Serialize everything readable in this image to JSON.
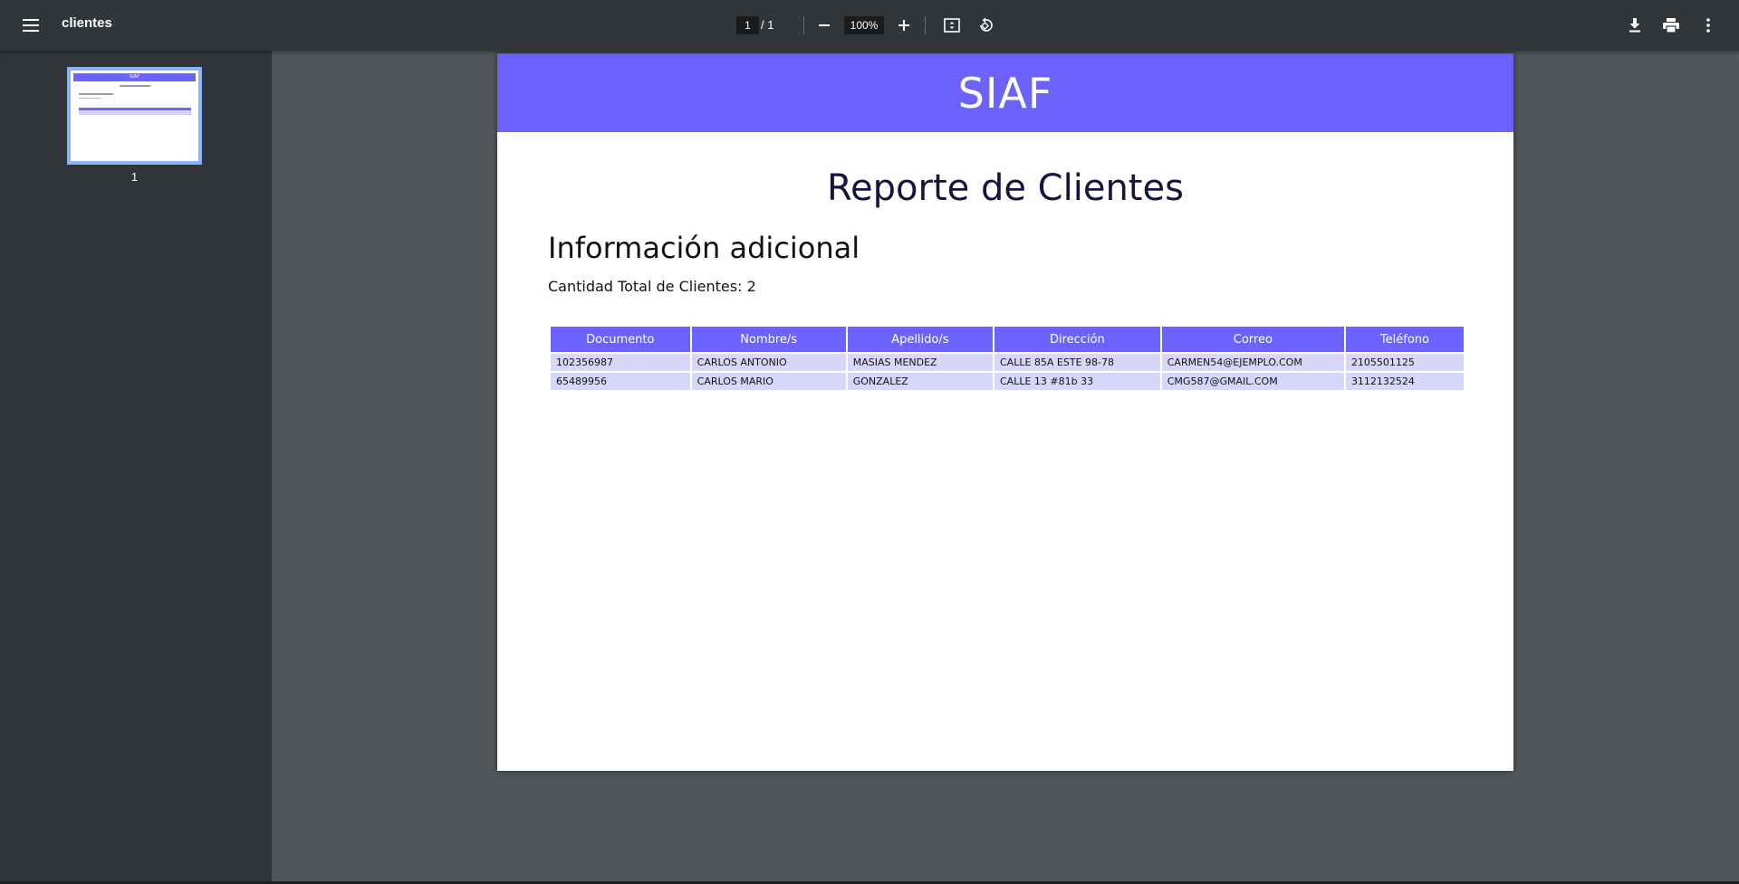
{
  "toolbar": {
    "title": "clientes",
    "current_page": "1",
    "page_separator": "/  1",
    "zoom": "100%"
  },
  "sidebar": {
    "thumbnails": [
      {
        "page_label": "1",
        "banner": "SIAF"
      }
    ]
  },
  "document": {
    "banner_title": "SIAF",
    "report_title": "Reporte de Clientes",
    "section_title": "Información adicional",
    "total_label": "Cantidad Total de Clientes:",
    "total_value": "2",
    "table": {
      "headers": [
        "Documento",
        "Nombre/s",
        "Apellido/s",
        "Dirección",
        "Correo",
        "Teléfono"
      ],
      "rows": [
        [
          "102356987",
          "CARLOS ANTONIO",
          "MASIAS MENDEZ",
          "CALLE 85A ESTE 98-78",
          "CARMEN54@EJEMPLO.COM",
          "2105501125"
        ],
        [
          "65489956",
          "CARLOS MARIO",
          "GONZALEZ",
          "CALLE 13 #81b 33",
          "CMG587@GMAIL.COM",
          "3112132524"
        ]
      ]
    }
  },
  "colors": {
    "toolbar_bg": "#323639",
    "viewer_bg": "#525659",
    "accent": "#6c63ff",
    "row_bg": "#d8d6fd",
    "thumb_border": "#8ab4f8"
  },
  "icons": {
    "menu": "hamburger-icon",
    "zoom_out": "minus-icon",
    "zoom_in": "plus-icon",
    "fit": "fit-page-icon",
    "rotate": "rotate-icon",
    "download": "download-icon",
    "print": "print-icon",
    "more": "more-vert-icon"
  }
}
